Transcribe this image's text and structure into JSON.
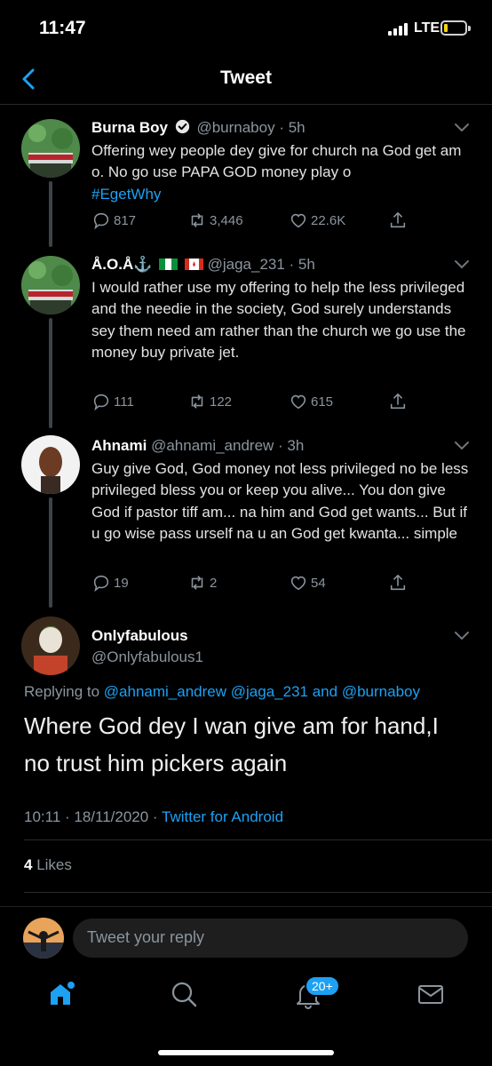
{
  "status": {
    "time": "11:47",
    "network": "LTE"
  },
  "header": {
    "title": "Tweet"
  },
  "thread": [
    {
      "name": "Burna Boy",
      "handle": "@burnaboy",
      "time": "5h",
      "text": "Offering wey people dey give for church na God get am o. No go use PAPA GOD money play o",
      "hashtag": "#EgetWhy",
      "replies": "817",
      "retweets": "3,446",
      "likes": "22.6K"
    },
    {
      "name": "Å.O.Å⚓",
      "handle": "@jaga_231",
      "time": "5h",
      "text": "I would rather use my offering to help the less privileged and the needie in the society, God surely understands sey them need am rather than the church we go use the money buy private jet.",
      "replies": "111",
      "retweets": "122",
      "likes": "615"
    },
    {
      "name": "Ahnami",
      "handle": "@ahnami_andrew",
      "time": "3h",
      "text": "Guy give God, God money not less privileged no be less privileged bless you or keep you alive... You don give God if pastor tiff am... na him and God get wants... But if u go wise pass urself na u an God get kwanta... simple",
      "replies": "19",
      "retweets": "2",
      "likes": "54"
    }
  ],
  "main": {
    "name": "Onlyfabulous",
    "handle": "@Onlyfabulous1",
    "replying_prefix": "Replying to",
    "mention1": "@ahnami_andrew",
    "mention2": "@jaga_231",
    "and": "and",
    "mention3": "@burnaboy",
    "text": "Where God dey I wan give am for hand,I no trust him pickers again",
    "datetime": "10:11 · 18/11/2020 ·",
    "source": "Twitter for Android",
    "likes_count": "4",
    "likes_label": "Likes"
  },
  "reply": {
    "placeholder": "Tweet your reply"
  },
  "tabs": {
    "notifications_badge": "20+"
  },
  "colors": {
    "accent": "#1da1f2",
    "background": "#000000",
    "muted": "#8b959e"
  }
}
